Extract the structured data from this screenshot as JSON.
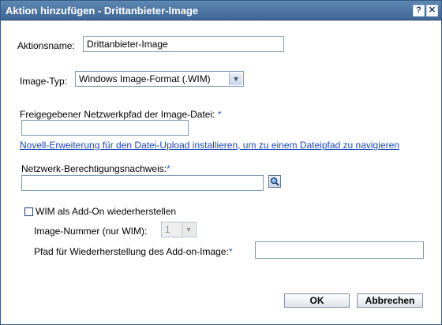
{
  "window": {
    "title": "Aktion hinzufügen - Drittanbieter-Image",
    "help_glyph": "?",
    "close_glyph": "✕"
  },
  "form": {
    "action_name_label": "Aktionsname:",
    "action_name_value": "Drittanbieter-Image",
    "image_type_label": "Image-Typ:",
    "image_type_selected": "Windows Image-Format (.WIM)",
    "network_path_label": "Freigegebener Netzwerkpfad der Image-Datei:",
    "network_path_required": "*",
    "network_path_value": "",
    "upload_link": "Novell-Erweiterung für den Datei-Upload installieren, um zu einem Dateipfad zu navigieren",
    "credentials_label": "Netzwerk-Berechtigungsnachweis:",
    "credentials_required": "*",
    "credentials_value": "",
    "wim_addon_label": "WIM als Add-On wiederherstellen",
    "wim_addon_checked": false,
    "image_number_label": "Image-Nummer (nur WIM):",
    "image_number_value": "1",
    "addon_path_label": "Pfad für Wiederherstellung des Add-on-Image:",
    "addon_path_required": "*",
    "addon_path_value": ""
  },
  "buttons": {
    "ok": "OK",
    "cancel": "Abbrechen"
  },
  "icons": {
    "search": "search-icon",
    "dropdown": "chevron-down-icon"
  },
  "colors": {
    "titlebar": "#4a72a0",
    "link": "#1b47b8",
    "required": "#2a55c9"
  }
}
